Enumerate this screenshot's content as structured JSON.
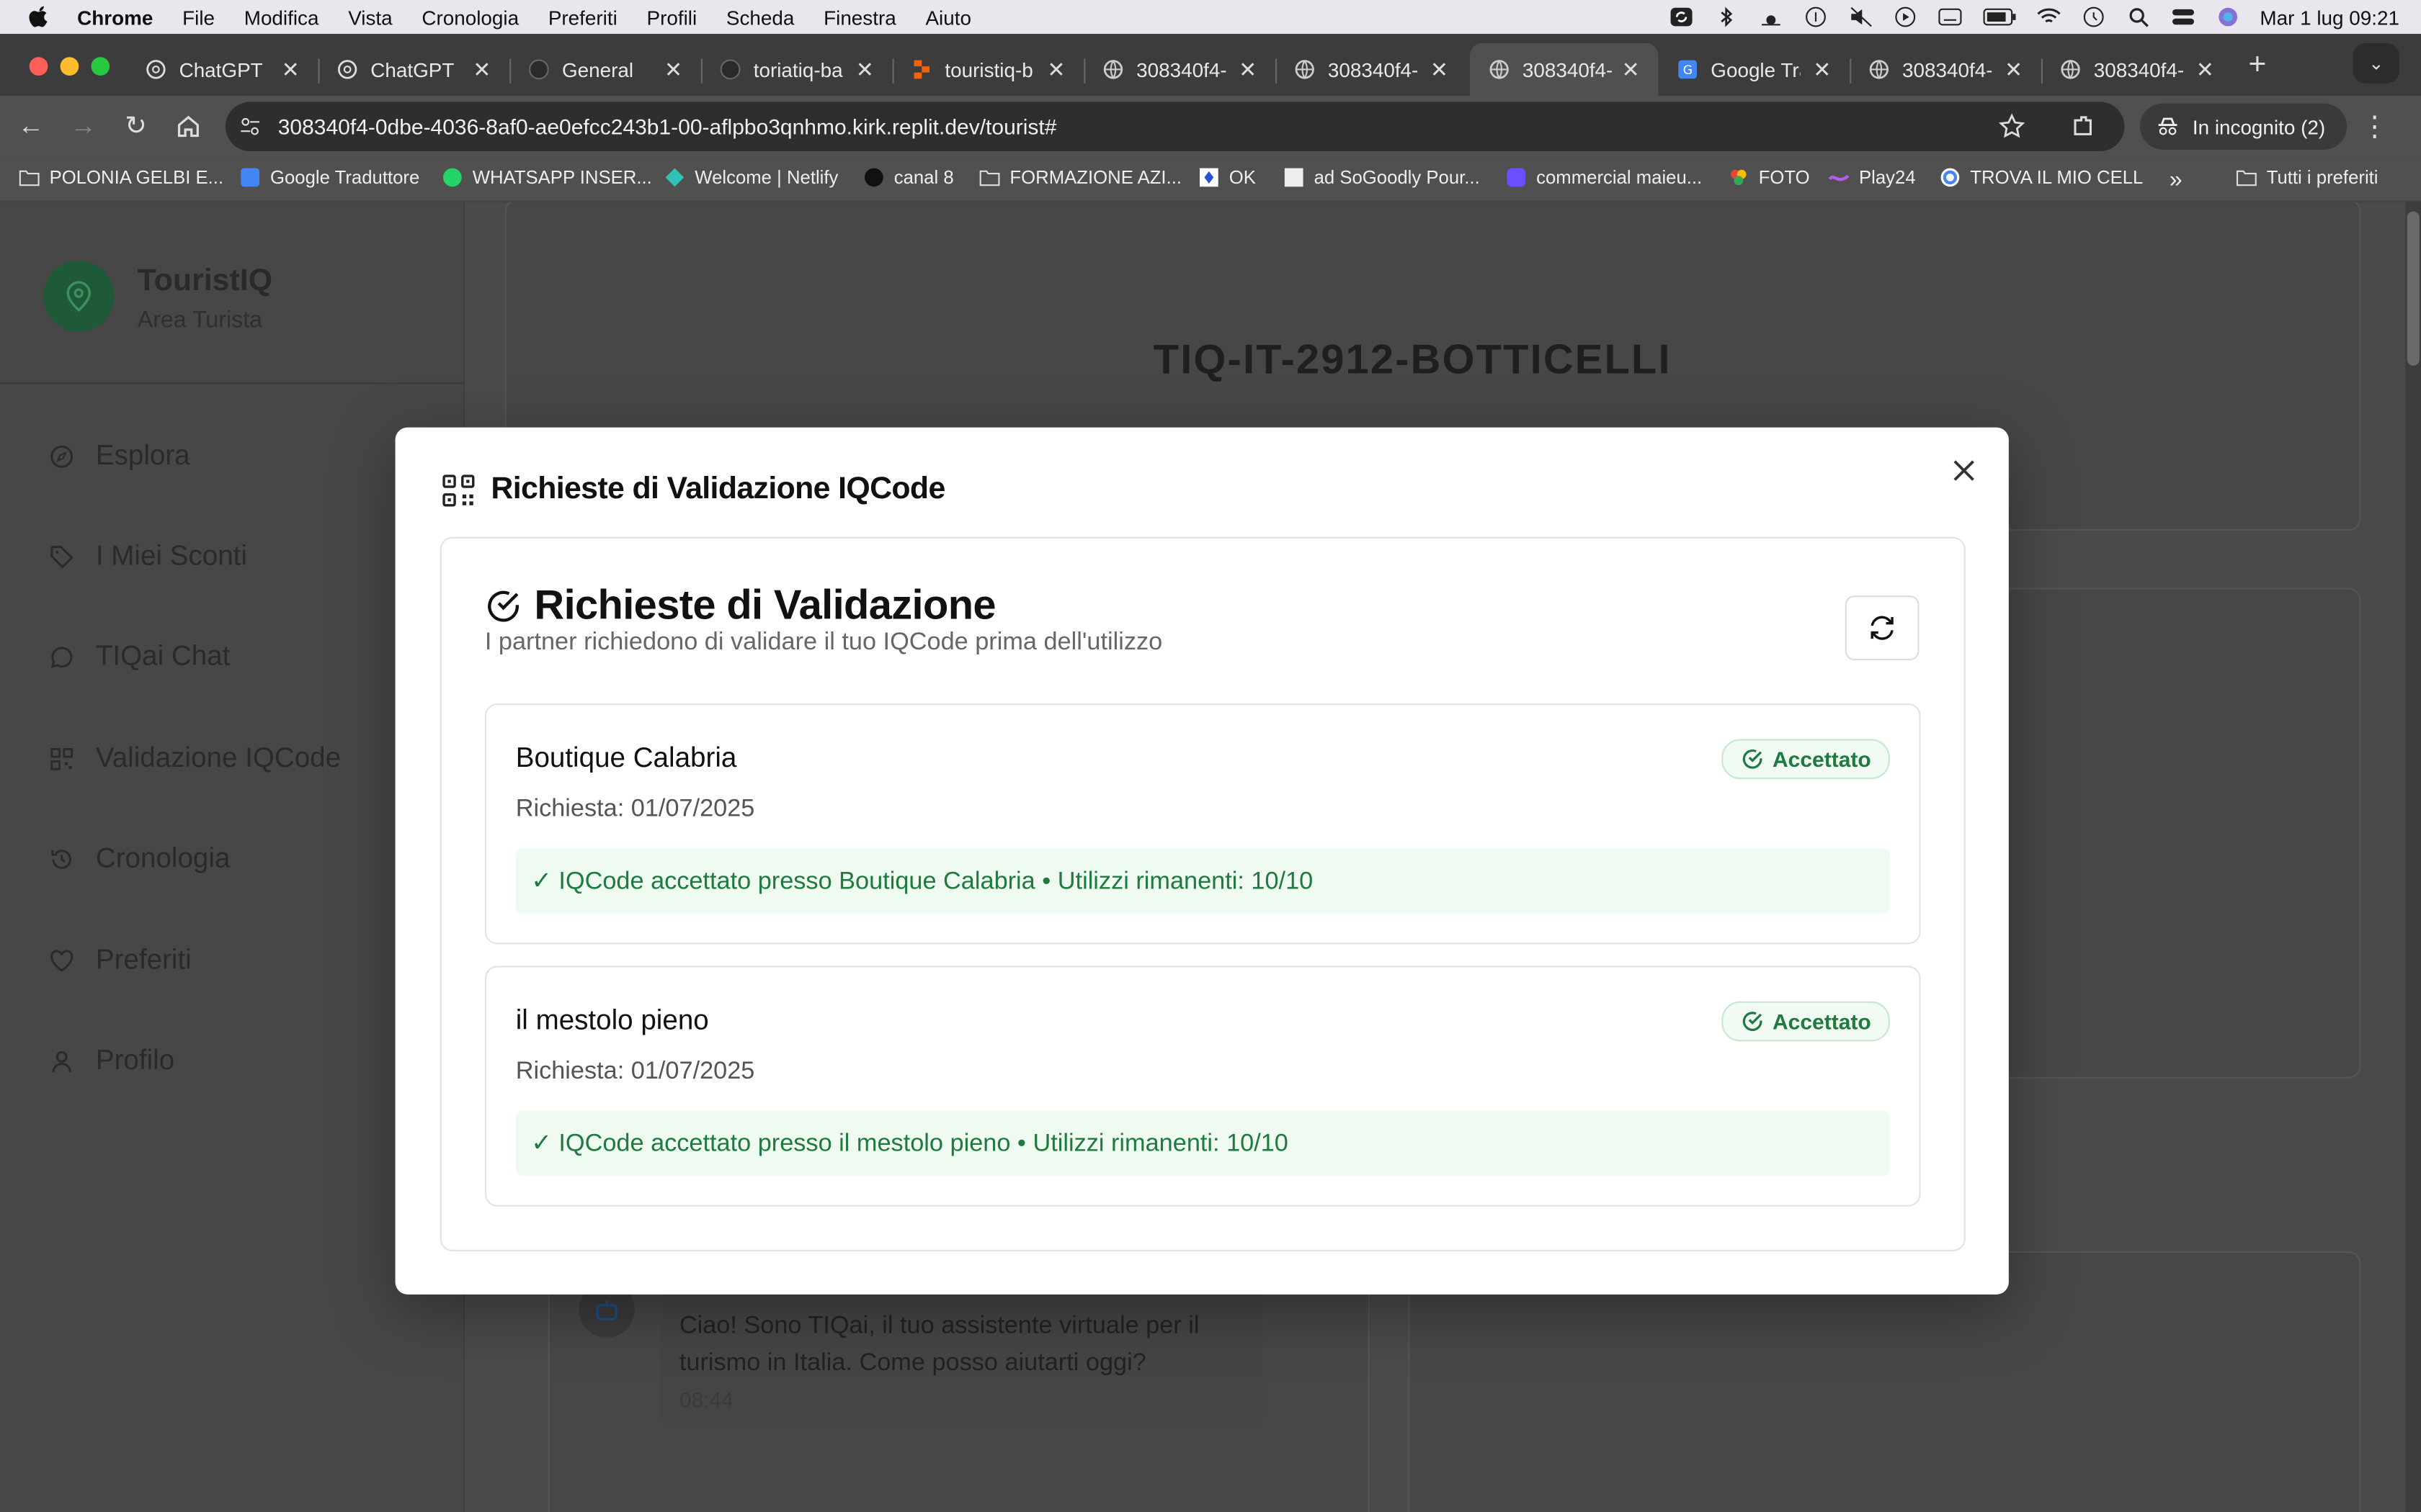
{
  "menubar": {
    "items": [
      "Chrome",
      "File",
      "Modifica",
      "Vista",
      "Cronologia",
      "Preferiti",
      "Profili",
      "Scheda",
      "Finestra",
      "Aiuto"
    ],
    "datetime": "Mar 1 lug  09:21"
  },
  "tabs": [
    "ChatGPT",
    "ChatGPT",
    "General",
    "toriatiq-ba",
    "touristiq-b",
    "308340f4-",
    "308340f4-",
    "308340f4-",
    "Google Tra",
    "308340f4-",
    "308340f4-"
  ],
  "toolbar": {
    "url": "308340f4-0dbe-4036-8af0-ae0efcc243b1-00-aflpbo3qnhmo.kirk.replit.dev/tourist#",
    "incognito": "In incognito (2)"
  },
  "bookmarks": [
    "POLONIA GELBI E...",
    "Google Traduttore",
    "WHATSAPP INSER...",
    "Welcome | Netlify",
    "canal 8",
    "FORMAZIONE AZI...",
    "OK",
    "ad SoGoodly Pour...",
    "commercial maieu...",
    "FOTO",
    "Play24",
    "TROVA IL MIO CELL",
    "Tutti i preferiti"
  ],
  "sidebar": {
    "brand": "TouristIQ",
    "subtitle": "Area Turista",
    "items": [
      "Esplora",
      "I Miei Sconti",
      "TIQai Chat",
      "Validazione IQCode",
      "Cronologia",
      "Preferiti",
      "Profilo"
    ]
  },
  "main": {
    "code": "TIQ-IT-2912-BOTTICELLI",
    "chat_message": "Ciao! Sono TIQai, il tuo assistente virtuale per il turismo in Italia. Come posso aiutarti oggi?",
    "chat_time": "08:44"
  },
  "modal": {
    "title": "Richieste di Validazione IQCode",
    "section_title": "Richieste di Validazione",
    "section_subtitle": "I partner richiedono di validare il tuo IQCode prima dell'utilizzo",
    "requests": [
      {
        "partner": "Boutique Calabria",
        "date": "Richiesta: 01/07/2025",
        "status": "Accettato",
        "message": "✓ IQCode accettato presso Boutique Calabria • Utilizzi rimanenti: 10/10"
      },
      {
        "partner": "il mestolo pieno",
        "date": "Richiesta: 01/07/2025",
        "status": "Accettato",
        "message": "✓ IQCode accettato presso il mestolo pieno • Utilizzi rimanenti: 10/10"
      }
    ]
  },
  "colors": {
    "accent_green": "#1e7a3f",
    "badge_bg": "#f1faf3",
    "message_bg": "#effaf1",
    "brand_green": "#1e5a38"
  }
}
